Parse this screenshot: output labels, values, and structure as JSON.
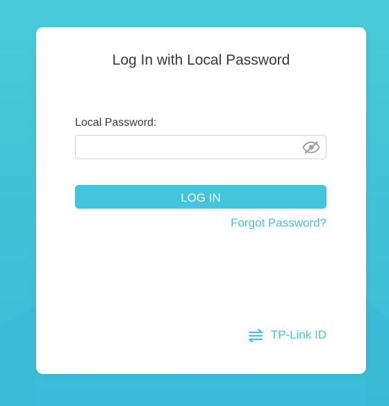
{
  "login": {
    "title": "Log In with Local Password",
    "password_label": "Local Password:",
    "password_value": "",
    "password_placeholder": "",
    "login_button": "LOG IN",
    "forgot_link": "Forgot Password?",
    "tplink_id_link": "TP-Link ID"
  },
  "icons": {
    "password_toggle": "eye-slash-icon",
    "tplink_id": "swap-arrows-icon"
  },
  "colors": {
    "accent": "#44c5db",
    "background": "#41c3d6",
    "card": "#ffffff",
    "text": "#333a3f"
  }
}
